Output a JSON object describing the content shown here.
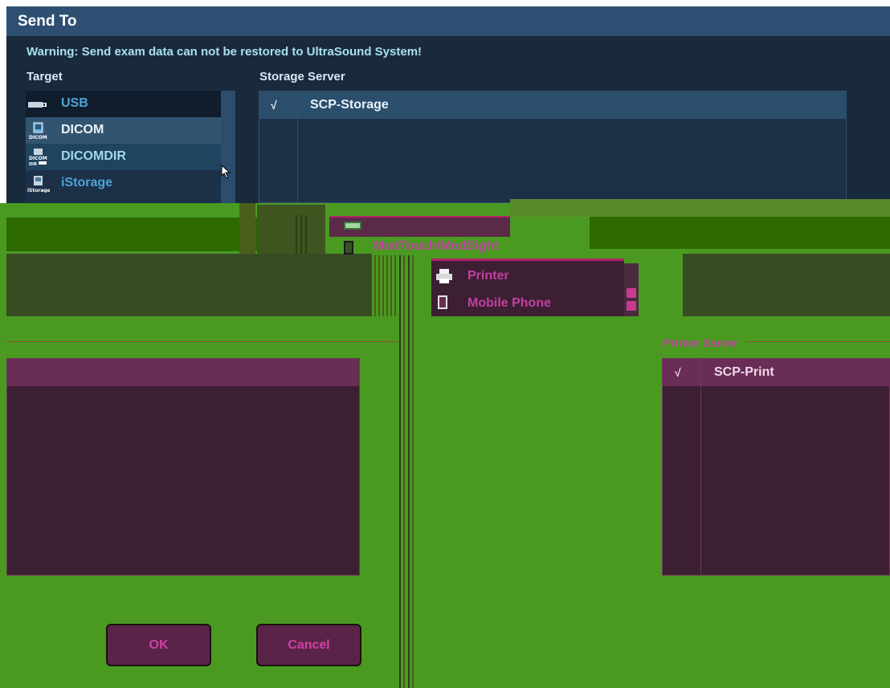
{
  "dialog": {
    "title": "Send To",
    "warning": "Warning: Send exam data can not be restored to UltraSound System!",
    "target_label": "Target",
    "storage_label": "Storage Server",
    "printer_label": "Printer Server"
  },
  "targets": [
    {
      "label": "USB",
      "icon": "usb-drive-icon"
    },
    {
      "label": "DICOM",
      "icon": "dicom-icon"
    },
    {
      "label": "DICOMDIR",
      "icon": "dicomdir-icon"
    },
    {
      "label": "iStorage",
      "icon": "istorage-icon"
    }
  ],
  "more_targets": [
    {
      "label": "MedTouch/MedSight",
      "icon": "tablet-icon"
    },
    {
      "label": "Printer",
      "icon": "printer-icon"
    },
    {
      "label": "Mobile Phone",
      "icon": "mobile-phone-icon"
    }
  ],
  "storage_servers": [
    {
      "check": "√",
      "name": "SCP-Storage"
    }
  ],
  "printer_servers": [
    {
      "check": "√",
      "name": "SCP-Print"
    }
  ],
  "buttons": {
    "ok": "OK",
    "cancel": "Cancel"
  },
  "colors": {
    "title_bar": "#2e4f72",
    "dialog_bg": "#1a2a3d",
    "glitch_green": "#4a9a22",
    "glitch_magenta": "#c040a0"
  }
}
